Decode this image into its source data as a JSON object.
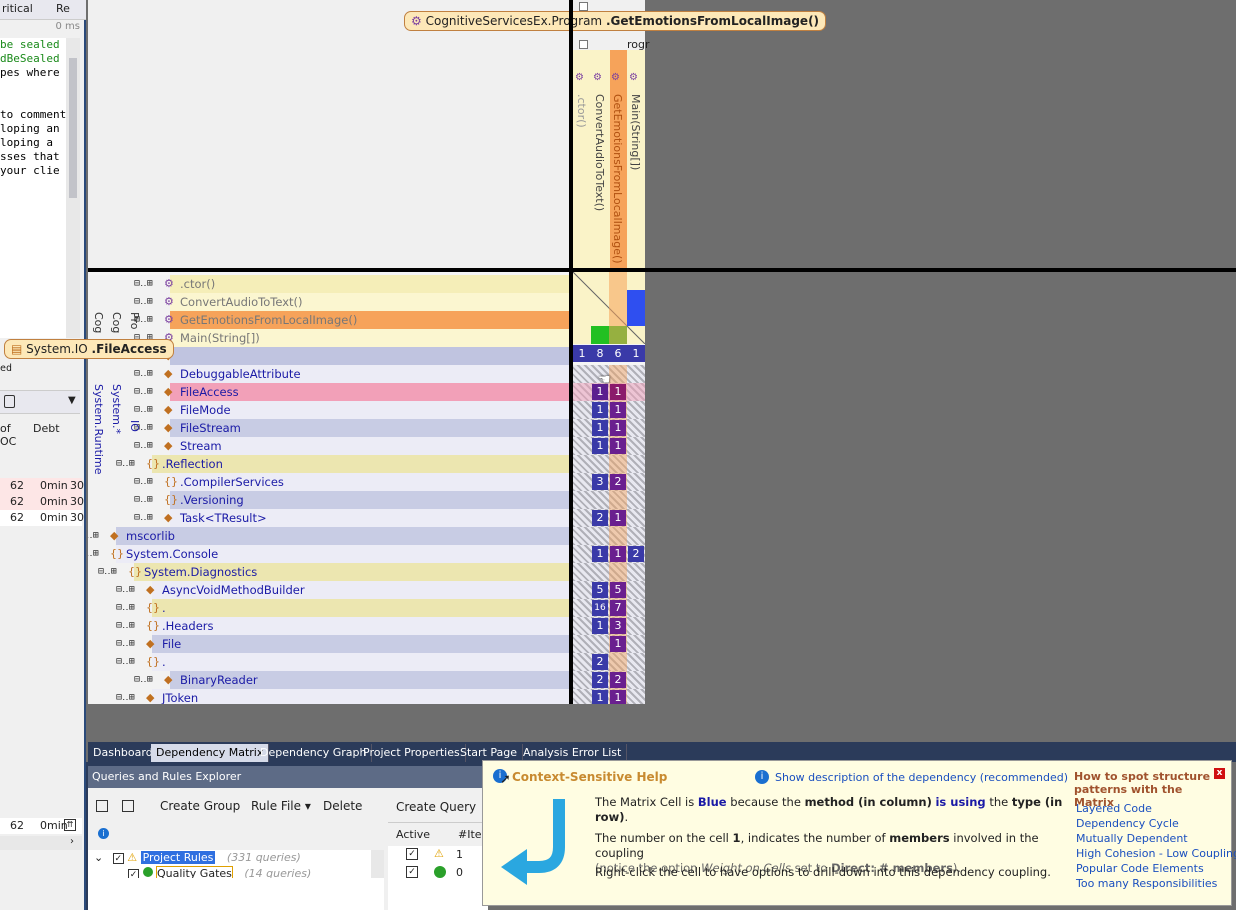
{
  "left_panel": {
    "header_critical": "ritical",
    "header_re": "Re",
    "ms_label": "0 ms",
    "code_lines": [
      "be sealed",
      "dBeSealed",
      "pes where",
      "",
      "",
      "to comment",
      "loping an",
      "loping a ",
      "sses that",
      "your clie"
    ],
    "col_of_loc": "of\nOC",
    "col_debt": "Debt",
    "rows": [
      {
        "loc": "62",
        "debt": "0min",
        "extra": "30"
      },
      {
        "loc": "62",
        "debt": "0min",
        "extra": "30"
      },
      {
        "loc": "62",
        "debt": "0min",
        "extra": "30"
      }
    ],
    "bottom_row": {
      "loc": "62",
      "debt": "0min"
    },
    "status_ed": "ed"
  },
  "tooltips": {
    "top_prefix": "CognitiveServicesEx.Program",
    "top_bold": ".GetEmotionsFromLocalImage()",
    "left_prefix": "System.IO",
    "left_bold": ".FileAccess"
  },
  "matrix": {
    "column_headers": [
      ".ctor()",
      "ConvertAudioToText()",
      "GetEmotionsFromLocalImage()",
      "Main(String[])"
    ],
    "column_stub": "rogr",
    "left_vertical_labels": [
      "Cog",
      "Cog",
      "Pro"
    ],
    "left_vertical_labels2": [
      "System.*",
      "IO",
      "System.Runtime"
    ],
    "rows": [
      {
        "label": ".ctor()",
        "style": "gray"
      },
      {
        "label": "ConvertAudioToText()",
        "style": "gray"
      },
      {
        "label": "GetEmotionsFromLocalImage()",
        "style": "gray"
      },
      {
        "label": "Main(String[])",
        "style": "gray"
      },
      {
        "label": "",
        "style": "gray"
      },
      {
        "label": "DebuggableAttribute",
        "style": "blue"
      },
      {
        "label": "FileAccess",
        "style": "blue"
      },
      {
        "label": "FileMode",
        "style": "blue"
      },
      {
        "label": "FileStream",
        "style": "blue"
      },
      {
        "label": "Stream",
        "style": "blue"
      },
      {
        "label": ".Reflection",
        "style": "blue"
      },
      {
        "label": ".CompilerServices",
        "style": "blue"
      },
      {
        "label": ".Versioning",
        "style": "blue"
      },
      {
        "label": "Task<TResult>",
        "style": "blue"
      },
      {
        "label": "mscorlib",
        "style": "blue"
      },
      {
        "label": "System.Console",
        "style": "blue"
      },
      {
        "label": "System.Diagnostics",
        "style": "blue"
      },
      {
        "label": "AsyncVoidMethodBuilder",
        "style": "blue"
      },
      {
        "label": ".",
        "style": "blue"
      },
      {
        "label": ".Headers",
        "style": "blue"
      },
      {
        "label": "File",
        "style": "blue"
      },
      {
        "label": ".",
        "style": "blue"
      },
      {
        "label": "BinaryReader",
        "style": "blue"
      },
      {
        "label": "JToken",
        "style": "blue"
      }
    ],
    "header_counts": [
      "1",
      "8",
      "6",
      "1"
    ],
    "cells": [
      {
        "row": 6,
        "col": 1,
        "value": "1",
        "color": "#5b1f8f"
      },
      {
        "row": 6,
        "col": 2,
        "value": "1",
        "color": "#8b1a6b"
      },
      {
        "row": 7,
        "col": 1,
        "value": "1",
        "color": "#3a3aa8"
      },
      {
        "row": 7,
        "col": 2,
        "value": "1",
        "color": "#6a1f8f"
      },
      {
        "row": 8,
        "col": 1,
        "value": "1",
        "color": "#3a3aa8"
      },
      {
        "row": 8,
        "col": 2,
        "value": "1",
        "color": "#6a1f8f"
      },
      {
        "row": 9,
        "col": 1,
        "value": "1",
        "color": "#3a3aa8"
      },
      {
        "row": 9,
        "col": 2,
        "value": "1",
        "color": "#6a1f8f"
      },
      {
        "row": 11,
        "col": 1,
        "value": "3",
        "color": "#3a3aa8"
      },
      {
        "row": 11,
        "col": 2,
        "value": "2",
        "color": "#6a1f8f"
      },
      {
        "row": 13,
        "col": 1,
        "value": "2",
        "color": "#3a3aa8"
      },
      {
        "row": 13,
        "col": 2,
        "value": "1",
        "color": "#6a1f8f"
      },
      {
        "row": 15,
        "col": 1,
        "value": "1",
        "color": "#3a3aa8"
      },
      {
        "row": 15,
        "col": 2,
        "value": "1",
        "color": "#6a1f8f"
      },
      {
        "row": 15,
        "col": 3,
        "value": "2",
        "color": "#3a3aa8"
      },
      {
        "row": 17,
        "col": 1,
        "value": "5",
        "color": "#3a3aa8"
      },
      {
        "row": 17,
        "col": 2,
        "value": "5",
        "color": "#6a1f8f"
      },
      {
        "row": 18,
        "col": 1,
        "value": "16",
        "color": "#3a3aa8"
      },
      {
        "row": 18,
        "col": 2,
        "value": "7",
        "color": "#6a1f8f"
      },
      {
        "row": 19,
        "col": 1,
        "value": "1",
        "color": "#3a3aa8"
      },
      {
        "row": 19,
        "col": 2,
        "value": "3",
        "color": "#6a1f8f"
      },
      {
        "row": 20,
        "col": 2,
        "value": "1",
        "color": "#6a1f8f"
      },
      {
        "row": 21,
        "col": 1,
        "value": "2",
        "color": "#3a3aa8"
      },
      {
        "row": 22,
        "col": 1,
        "value": "2",
        "color": "#3a3aa8"
      },
      {
        "row": 22,
        "col": 2,
        "value": "2",
        "color": "#6a1f8f"
      },
      {
        "row": 23,
        "col": 1,
        "value": "1",
        "color": "#3a3aa8"
      },
      {
        "row": 23,
        "col": 2,
        "value": "1",
        "color": "#6a1f8f"
      }
    ]
  },
  "tabs": [
    "Dashboard",
    "Dependency Matrix",
    "Dependency Graph",
    "Project Properties",
    "Start Page",
    "Analysis Error List"
  ],
  "qre": {
    "title": "Queries and Rules Explorer",
    "create_group": "Create Group",
    "rule_file": "Rule File",
    "delete": "Delete",
    "create_query": "Create Query",
    "col_active": "Active",
    "col_items": "#Iter",
    "rows": [
      {
        "name": "Project Rules",
        "count": "(331 queries)",
        "items": "1"
      },
      {
        "name": "Quality Gates",
        "count": "(14 queries)",
        "items": "0"
      }
    ]
  },
  "help": {
    "title": "Context-Sensitive Help",
    "show_link": "Show description of the dependency (recommended)",
    "p1_a": "The Matrix Cell is ",
    "p1_blue": "Blue",
    "p1_b": " because the ",
    "p1_method": "method (in column)",
    "p1_c": " ",
    "p1_using": "is using",
    "p1_d": " the ",
    "p1_type": "type (in row)",
    "p1_e": ".",
    "p2_a": "The number on the cell ",
    "p2_num": "1",
    "p2_b": ", indicates the number of ",
    "p2_members": "members",
    "p2_c": " involved in the coupling",
    "p2_note_a": "(notice the option ",
    "p2_note_i": "Weight on Cells",
    "p2_note_b": " set to ",
    "p2_note_bold": "Direct: # members",
    "p2_note_c": ").",
    "p3": "Right-click the cell to have options to drill-down into this dependency coupling.",
    "side_title": "How to spot structure patterns with the Matrix",
    "side_links": [
      "Layered Code",
      "Dependency Cycle",
      "Mutually Dependent",
      "High Cohesion - Low Coupling",
      "Popular Code Elements",
      "Too many Responsibilities"
    ],
    "close": "x"
  },
  "colors": {
    "gray_row": "#f5f0c0",
    "blue_row": "#c8cce4",
    "highlight_orange": "#f6a35a",
    "highlight_pink": "#f2a0b8",
    "accent_blue": "#3a3aa8"
  }
}
